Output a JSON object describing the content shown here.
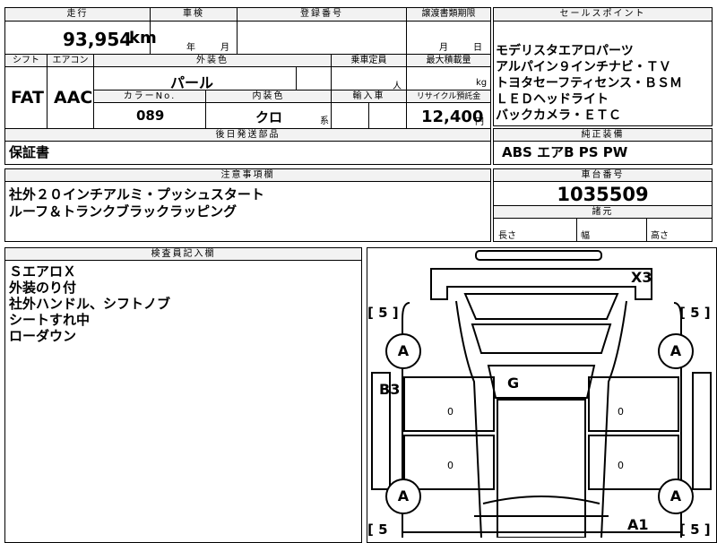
{
  "top": {
    "mileage_header": "走行",
    "mileage_value": "93,954",
    "mileage_unit": "km",
    "inspection_header": "車検",
    "year_label": "年",
    "month_label": "月",
    "registration_header": "登録番号",
    "transfer_header": "譲渡書類期限",
    "transfer_month": "月",
    "transfer_day": "日"
  },
  "specs": {
    "shift_header": "シフト",
    "shift_value": "FAT",
    "ac_header": "エアコン",
    "ac_value": "AAC",
    "color_header": "外装色",
    "color_value": "パール",
    "capacity_header": "乗車定員",
    "capacity_unit": "人",
    "load_header": "最大積載量",
    "load_unit": "kg",
    "color_no_header": "カラーNo.",
    "color_no_value": "089",
    "interior_header": "内装色",
    "interior_value": "クロ",
    "interior_suffix": "系",
    "import_header": "輸入車",
    "recycle_header": "リサイクル預託金",
    "recycle_value": "12,400",
    "recycle_unit": "円"
  },
  "later_parts": {
    "header": "後日発送部品",
    "value": "保証書"
  },
  "notes": {
    "header": "注意事項欄",
    "lines": [
      "社外２０インチアルミ・プッシュスタート",
      "ルーフ＆トランクブラックラッピング"
    ]
  },
  "inspector": {
    "header": "検査員記入欄",
    "lines": [
      "ＳエアロＸ",
      "外装のり付",
      "社外ハンドル、シフトノブ",
      "シートすれ中",
      "ローダウン"
    ]
  },
  "sales_points": {
    "header": "セールスポイント",
    "lines": [
      "モデリスタエアロパーツ",
      "アルパイン９インチナビ・ＴＶ",
      "トヨタセーフティセンス・ＢＳＭ",
      "ＬＥＤヘッドライト",
      "バックカメラ・ＥＴＣ"
    ]
  },
  "equipment": {
    "header": "純正装備",
    "value": "ABS エアB PS PW"
  },
  "chassis": {
    "header": "車台番号",
    "value": "1035509"
  },
  "dimensions": {
    "header": "諸元",
    "length_label": "長さ",
    "width_label": "幅",
    "height_label": "高さ"
  },
  "diagram": {
    "x3": "X3",
    "g": "G",
    "b3": "B3",
    "a1": "A1",
    "tire_front_left": "A",
    "tire_front_right": "A",
    "tire_rear_left": "A",
    "tire_rear_right": "A",
    "tread_fl": "[ 5 ]",
    "tread_fr": "[ 5 ]",
    "tread_rl": "[ 5",
    "tread_rr": "[ 5 ]",
    "zero_left_top": "0",
    "zero_left_bottom": "0",
    "zero_right_top": "0",
    "zero_right_bottom": "0"
  }
}
